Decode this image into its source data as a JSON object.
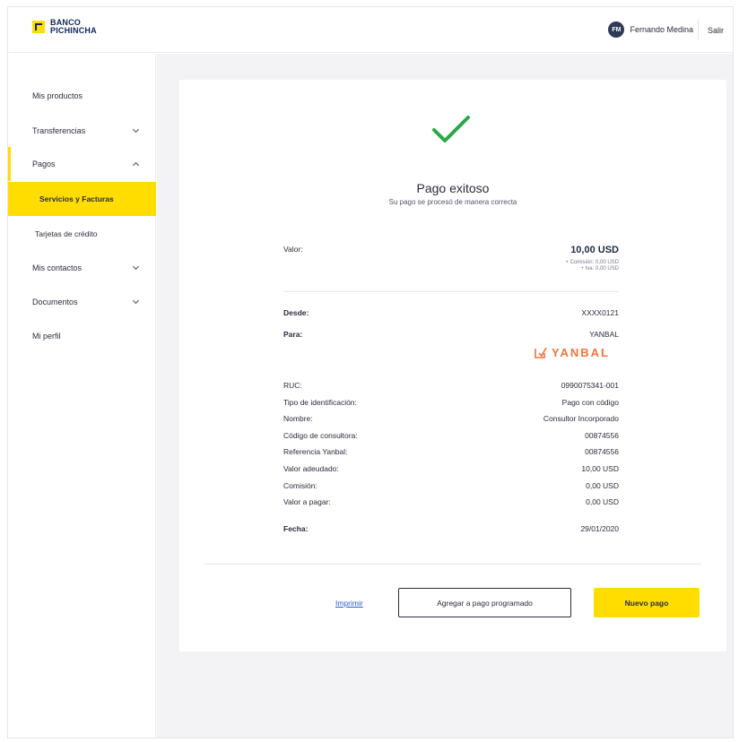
{
  "header": {
    "logo_line1": "BANCO",
    "logo_line2": "PICHINCHA",
    "avatar_initials": "FM",
    "user_name": "Fernando Medina",
    "logout": "Salir"
  },
  "sidebar": {
    "items": [
      {
        "label": "Mis productos"
      },
      {
        "label": "Transferencias"
      },
      {
        "label": "Pagos"
      },
      {
        "label": "Servicios y Facturas"
      },
      {
        "label": "Tarjetas de crédito"
      },
      {
        "label": "Mis contactos"
      },
      {
        "label": "Documentos"
      },
      {
        "label": "Mi perfil"
      }
    ]
  },
  "receipt": {
    "title": "Pago exitoso",
    "subtitle": "Su pago se procesó de manera correcta",
    "valor_label": "Valor:",
    "valor_value": "10,00 USD",
    "valor_fine_1": "+ Comisión: 0,00 USD",
    "valor_fine_2": "+ Iva: 0,00 USD",
    "desde_label": "Desde:",
    "desde_value": "XXXX0121",
    "para_label": "Para:",
    "para_value": "YANBAL",
    "brand_logo": "YANBAL",
    "details": [
      {
        "label": "RUC:",
        "value": "0990075341-001"
      },
      {
        "label": "Tipo de identificación:",
        "value": "Pago con código"
      },
      {
        "label": "Nombre:",
        "value": "Consultor Incorporado"
      },
      {
        "label": "Código de consultora:",
        "value": "00874556"
      },
      {
        "label": "Referencia Yanbal:",
        "value": "00874556"
      },
      {
        "label": "Valor adeudado:",
        "value": "10,00 USD"
      },
      {
        "label": "Comisión:",
        "value": "0,00 USD"
      },
      {
        "label": "Valor a pagar:",
        "value": "0,00 USD"
      }
    ],
    "fecha_label": "Fecha:",
    "fecha_value": "29/01/2020"
  },
  "actions": {
    "print": "Imprimir",
    "schedule": "Agregar a pago programado",
    "new_payment": "Nuevo pago"
  },
  "colors": {
    "brand_yellow": "#ffdd00",
    "success_green": "#2aa84a",
    "yanbal_orange": "#f0743c",
    "link_blue": "#2d5bd8"
  }
}
